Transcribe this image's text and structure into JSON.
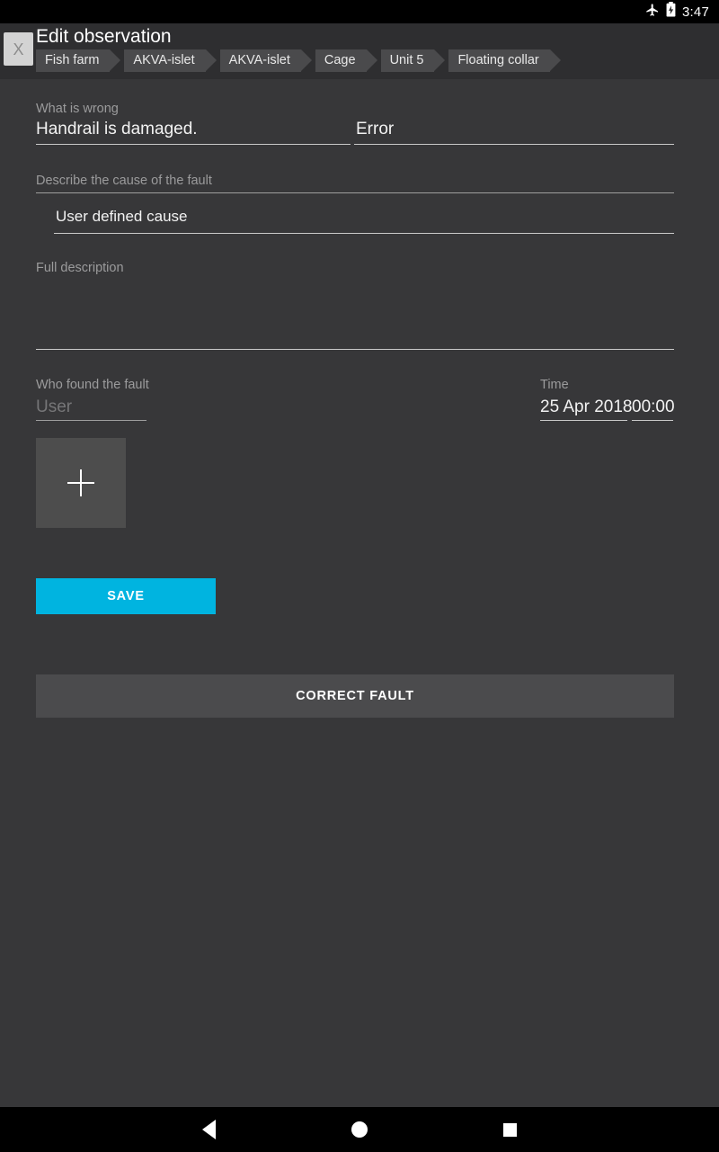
{
  "statusbar": {
    "airplane_icon": "airplane-mode-icon",
    "battery_icon": "battery-charging-icon",
    "time": "3:47"
  },
  "header": {
    "close_label": "X",
    "title": "Edit observation",
    "breadcrumbs": [
      {
        "label": "Fish farm"
      },
      {
        "label": "AKVA-islet"
      },
      {
        "label": "AKVA-islet"
      },
      {
        "label": "Cage"
      },
      {
        "label": "Unit 5"
      },
      {
        "label": "Floating collar"
      }
    ]
  },
  "form": {
    "what_is_wrong": {
      "label": "What is wrong",
      "fault_value": "Handrail is damaged.",
      "type_value": "Error"
    },
    "cause": {
      "label": "Describe the cause of the fault",
      "value": "User defined cause"
    },
    "full_description": {
      "label": "Full description",
      "value": ""
    },
    "who_found": {
      "label": "Who found the fault",
      "value": "User"
    },
    "time": {
      "label": "Time",
      "date_value": "25 Apr 2018",
      "time_value": "00:00"
    },
    "add_photo": {
      "icon": "plus-icon"
    }
  },
  "actions": {
    "save_label": "SAVE",
    "correct_fault_label": "CORRECT FAULT"
  },
  "navbar": {
    "back_icon": "back-triangle-icon",
    "home_icon": "home-circle-icon",
    "recents_icon": "recents-square-icon"
  },
  "colors": {
    "accent": "#00b4e0",
    "background": "#373739",
    "header_background": "#2e2e30",
    "chip": "#4a4a4c",
    "tile": "#4d4d4d",
    "secondary_button": "#4b4b4d"
  }
}
